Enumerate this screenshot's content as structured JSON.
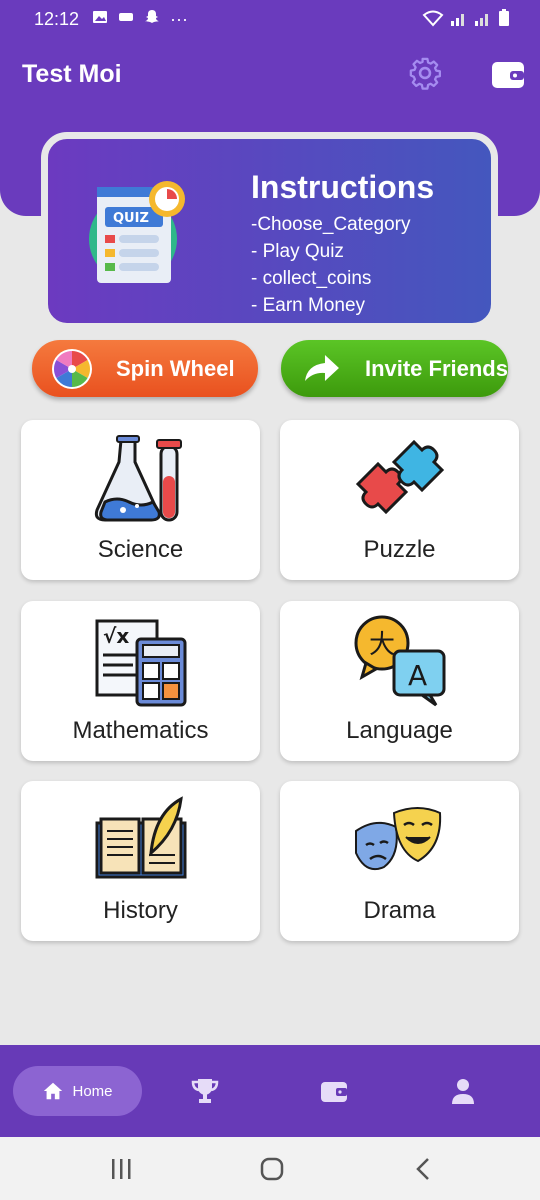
{
  "status_bar": {
    "time": "12:12",
    "overflow_dots": "···"
  },
  "header": {
    "title": "Test Moi",
    "settings_icon": "gear-icon",
    "wallet_icon": "wallet-icon"
  },
  "instructions": {
    "title": "Instructions",
    "illustration_text": "QUIZ",
    "items": [
      "-Choose_Category",
      "- Play Quiz",
      "- collect_coins",
      "- Earn Money"
    ]
  },
  "actions": {
    "spin_label": "Spin Wheel",
    "invite_label": "Invite Friends"
  },
  "categories": [
    {
      "label": "Science",
      "icon": "chemistry-flasks-icon"
    },
    {
      "label": "Puzzle",
      "icon": "puzzle-pieces-icon"
    },
    {
      "label": "Mathematics",
      "icon": "calculator-icon"
    },
    {
      "label": "Language",
      "icon": "translate-bubbles-icon"
    },
    {
      "label": "History",
      "icon": "book-feather-icon"
    },
    {
      "label": "Drama",
      "icon": "theater-masks-icon"
    }
  ],
  "bottom_nav": {
    "home_label": "Home",
    "items": [
      "home-icon",
      "trophy-icon",
      "wallet-icon",
      "profile-icon"
    ]
  },
  "colors": {
    "primary": "#673ab7",
    "spin": "#ef6a31",
    "invite": "#4cb01a",
    "background": "#e8e8e8"
  }
}
